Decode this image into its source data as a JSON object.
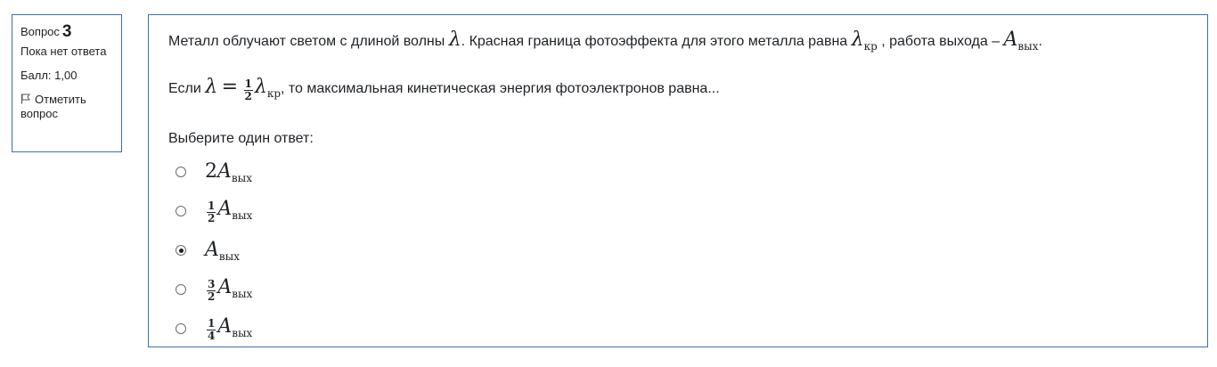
{
  "info": {
    "question_label": "Вопрос",
    "question_number": "3",
    "state": "Пока нет ответа",
    "grade": "Балл: 1,00",
    "flag_label": "Отметить вопрос"
  },
  "question": {
    "line1_part1": "Металл облучают светом с длиной волны",
    "lambda": "λ",
    "line1_part2": ". Красная граница фотоэффекта для этого металла равна",
    "lambda_kr_sub": "кр",
    "line1_part3": ", работа выхода –",
    "A": "A",
    "A_sub": "вых",
    "line1_end": ".",
    "line2_part1": "Если",
    "eq": "=",
    "half_num": "1",
    "half_den": "2",
    "line2_part2": ", то максимальная кинетическая энергия фотоэлектронов равна..."
  },
  "prompt": "Выберите один ответ:",
  "answers": [
    {
      "coef": "2",
      "frac_num": "",
      "frac_den": "",
      "A": "A",
      "sub": "вых",
      "checked": false
    },
    {
      "coef": "",
      "frac_num": "1",
      "frac_den": "2",
      "A": "A",
      "sub": "вых",
      "checked": false
    },
    {
      "coef": "",
      "frac_num": "",
      "frac_den": "",
      "A": "A",
      "sub": "вых",
      "checked": true
    },
    {
      "coef": "",
      "frac_num": "3",
      "frac_den": "2",
      "A": "A",
      "sub": "вых",
      "checked": false
    },
    {
      "coef": "",
      "frac_num": "1",
      "frac_den": "4",
      "A": "A",
      "sub": "вых",
      "checked": false
    }
  ]
}
